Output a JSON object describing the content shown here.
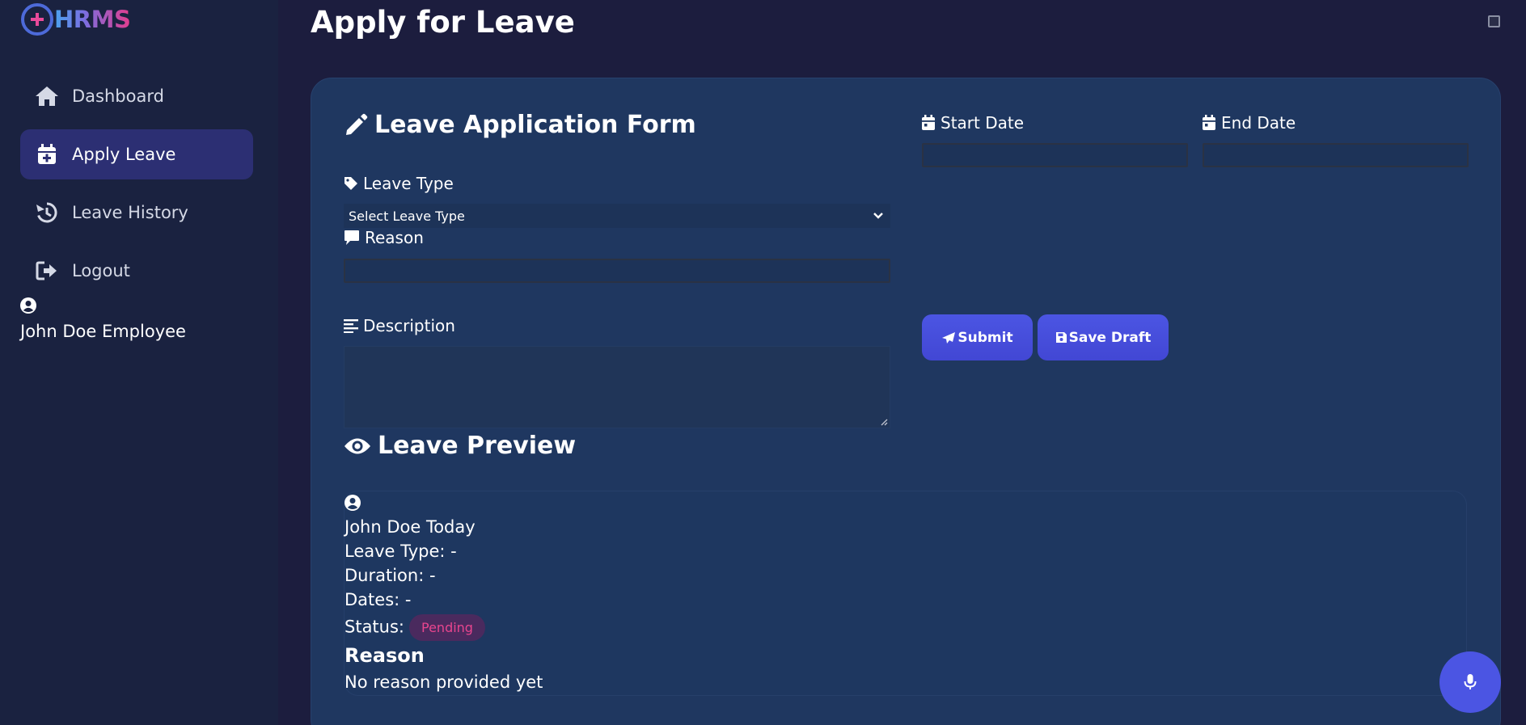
{
  "app": {
    "logo_text": "HRMS"
  },
  "sidebar": {
    "items": [
      {
        "label": "Dashboard",
        "icon": "home-icon"
      },
      {
        "label": "Apply Leave",
        "icon": "calendar-plus-icon",
        "active": true
      },
      {
        "label": "Leave History",
        "icon": "history-icon"
      },
      {
        "label": "Logout",
        "icon": "logout-icon"
      }
    ],
    "user": {
      "name": "John Doe Employee",
      "icon": "user-circle-icon"
    }
  },
  "page": {
    "title": "Apply for Leave"
  },
  "form": {
    "title": "Leave Application Form",
    "leave_type_label": "Leave Type",
    "leave_type_selected": "Select Leave Type",
    "reason_label": "Reason",
    "reason_value": "",
    "description_label": "Description",
    "description_value": "",
    "start_date_label": "Start Date",
    "start_date_value": "",
    "end_date_label": "End Date",
    "end_date_value": "",
    "submit_label": "Submit",
    "save_draft_label": "Save Draft"
  },
  "preview": {
    "title": "Leave Preview",
    "user_line": "John Doe Today",
    "leave_type": "Leave Type: -",
    "duration": "Duration: -",
    "dates": "Dates: -",
    "status_label": "Status:",
    "status_value": "Pending",
    "reason_heading": "Reason",
    "reason_text": "No reason provided yet"
  },
  "colors": {
    "background": "#1c1d3e",
    "sidebar": "#1a2240",
    "card": "#1f3760",
    "accent": "#4b55e3",
    "status_pending": "#e8458e"
  }
}
